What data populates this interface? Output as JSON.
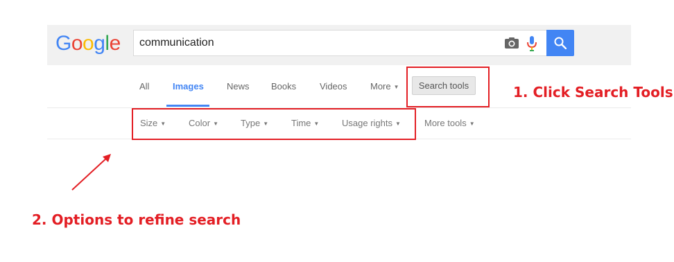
{
  "logo": {
    "text": "Google"
  },
  "search": {
    "query": "communication"
  },
  "tabs": [
    {
      "label": "All"
    },
    {
      "label": "Images"
    },
    {
      "label": "News"
    },
    {
      "label": "Books"
    },
    {
      "label": "Videos"
    },
    {
      "label": "More"
    }
  ],
  "search_tools_label": "Search tools",
  "tools": [
    {
      "label": "Size"
    },
    {
      "label": "Color"
    },
    {
      "label": "Type"
    },
    {
      "label": "Time"
    },
    {
      "label": "Usage rights"
    },
    {
      "label": "More tools"
    }
  ],
  "annotations": {
    "step1": "1. Click Search Tools",
    "step2": "2. Options to refine search"
  },
  "colors": {
    "accent_blue": "#4285f4",
    "annotation_red": "#e31e24"
  }
}
